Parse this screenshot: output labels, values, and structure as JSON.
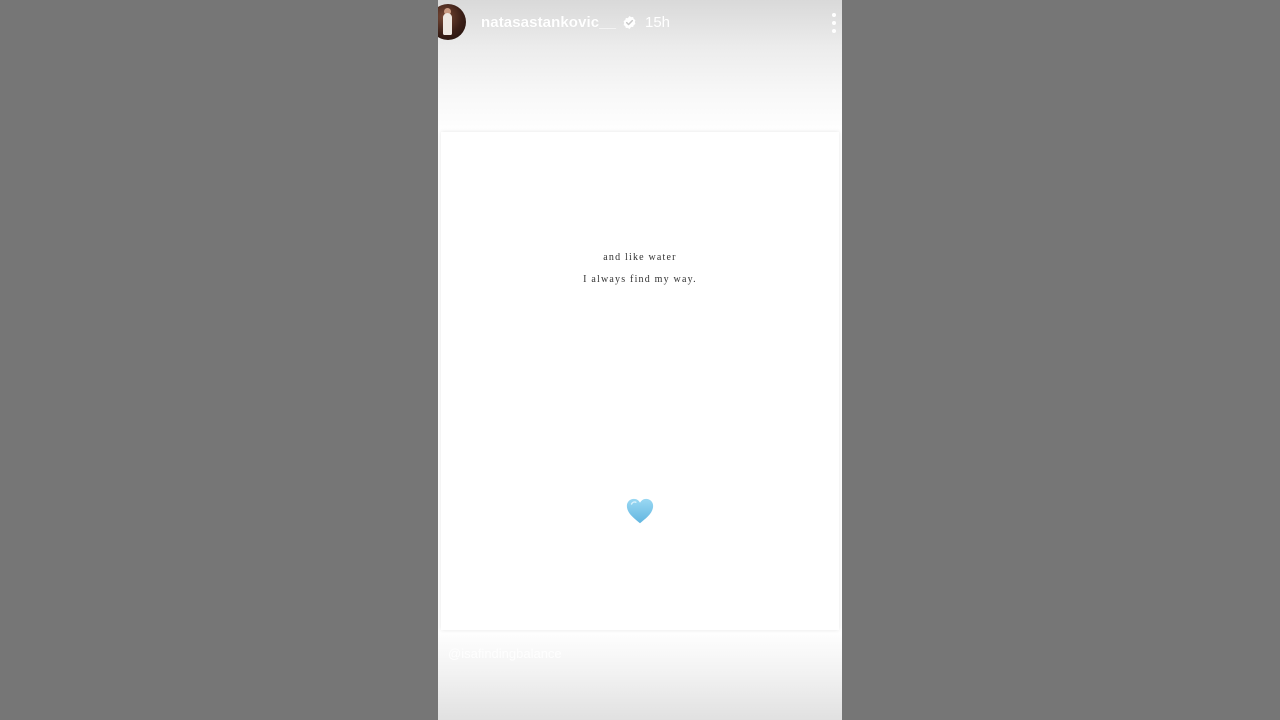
{
  "story": {
    "username": "natasastankovic__",
    "time_ago": "15h",
    "verified": true,
    "quote": {
      "line1": "and like water",
      "line2": "I always find my way."
    },
    "emoji": "light-blue-heart",
    "attribution": "@isafindingbalance"
  },
  "colors": {
    "side_background": "#767676",
    "heart": "#7fc8ea",
    "text": "#333333"
  },
  "icons": {
    "verified": "verified-badge-icon",
    "more": "more-options-icon",
    "heart": "heart-emoji-icon"
  }
}
